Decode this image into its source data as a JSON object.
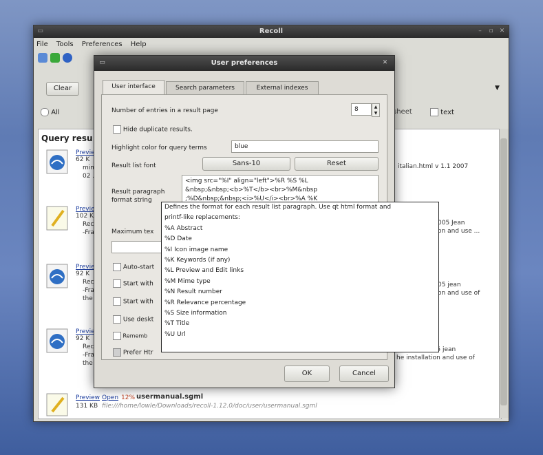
{
  "main": {
    "title": "Recoll",
    "menu": [
      "File",
      "Tools",
      "Preferences",
      "Help"
    ],
    "clear_label": "Clear",
    "all_label": "All",
    "filter_sheet_label": "sheet",
    "filter_text_label": "text",
    "query_header": "Query resu",
    "results": [
      {
        "preview": "Previe",
        "size": "62 K",
        "snippet": [
          "mim",
          "02 ."
        ],
        "right_text": "italian.html v 1.1 2007"
      },
      {
        "preview": "Previe",
        "size": "102 K",
        "snippet": [
          "Rec",
          "-Fra"
        ],
        "right_text": "005 Jean\non and use ..."
      },
      {
        "preview": "Previe",
        "size": "92 K",
        "snippet": [
          "Rec",
          "-Fra",
          "the"
        ],
        "right_text": "05 jean\non and use of"
      },
      {
        "preview": "Previe",
        "size": "92 K",
        "snippet": [
          "Rec",
          "-Fra",
          "the"
        ],
        "right_text": "yright © 2005 jean\nhe installation and use of"
      },
      {
        "preview": "Preview",
        "open": "Open",
        "pct": "12%",
        "name": "usermanual.sgml",
        "size": "131 KB",
        "path": "file:///home/lowle/Downloads/recoll-1.12.0/doc/user/usermanual.sgml"
      }
    ]
  },
  "dialog": {
    "title": "User preferences",
    "tabs": [
      "User interface",
      "Search parameters",
      "External indexes"
    ],
    "entries_label": "Number of entries in a result page",
    "entries_value": "8",
    "hide_dup_label": "Hide duplicate results.",
    "highlight_label": "Highlight color for query terms",
    "highlight_value": "blue",
    "font_label": "Result list font",
    "font_value": "Sans-10",
    "reset_label": "Reset",
    "para_label_1": "Result paragraph",
    "para_label_2": "format string",
    "para_value": [
      "<img src=\"%I\" align=\"left\">%R %S %L",
      "&nbsp;&nbsp;<b>%T</b><br>%M&nbsp",
      ";%D&nbsp;&nbsp;<i>%U</i><br>%A %K"
    ],
    "max_label": "Maximum tex",
    "options": [
      "Auto-start",
      "Start with",
      "Start with",
      "Use deskt",
      "Rememb",
      "Prefer Htr"
    ],
    "ok_label": "OK",
    "cancel_label": "Cancel"
  },
  "tooltip": {
    "lines": [
      "Defines the format for each result list paragraph. Use qt html format and",
      "printf-like replacements:",
      "%A Abstract",
      "%D Date",
      "%I Icon image name",
      "%K Keywords (if any)",
      "%L Preview and Edit links",
      "%M Mime type",
      "%N Result number",
      "%R Relevance percentage",
      "%S Size information",
      "%T Title",
      "%U Url"
    ]
  }
}
